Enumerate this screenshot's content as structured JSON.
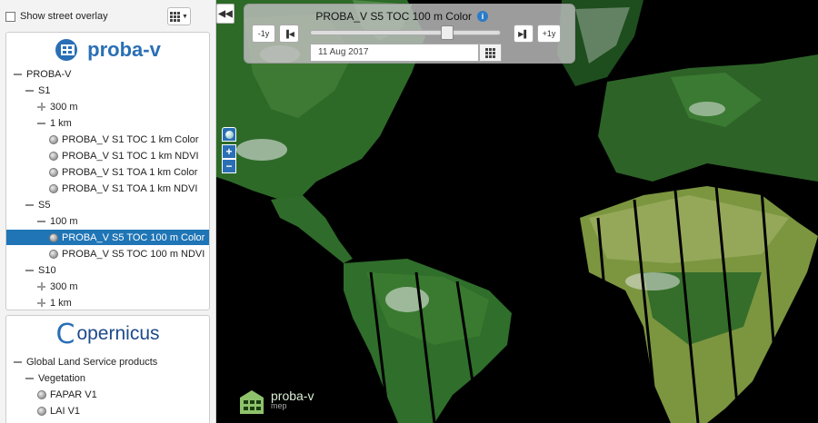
{
  "overlay": {
    "label": "Show street overlay",
    "checked": false,
    "grid_icon": "grid-icon"
  },
  "proba_logo": {
    "text": "proba-v"
  },
  "proba_tree": [
    {
      "label": "PROBA-V",
      "icon": "minus",
      "level": 0
    },
    {
      "label": "S1",
      "icon": "minus",
      "level": 1
    },
    {
      "label": "300 m",
      "icon": "plus",
      "level": 2
    },
    {
      "label": "1 km",
      "icon": "minus",
      "level": 2
    },
    {
      "label": "PROBA_V S1 TOC 1 km Color",
      "icon": "globe",
      "level": 3
    },
    {
      "label": "PROBA_V S1 TOC 1 km NDVI",
      "icon": "globe",
      "level": 3
    },
    {
      "label": "PROBA_V S1 TOA 1 km Color",
      "icon": "globe",
      "level": 3
    },
    {
      "label": "PROBA_V S1 TOA 1 km NDVI",
      "icon": "globe",
      "level": 3
    },
    {
      "label": "S5",
      "icon": "minus",
      "level": 1
    },
    {
      "label": "100 m",
      "icon": "minus",
      "level": 2
    },
    {
      "label": "PROBA_V S5 TOC 100 m Color",
      "icon": "globe",
      "level": 3,
      "selected": true
    },
    {
      "label": "PROBA_V S5 TOC 100 m NDVI",
      "icon": "globe",
      "level": 3
    },
    {
      "label": "S10",
      "icon": "minus",
      "level": 1
    },
    {
      "label": "300 m",
      "icon": "plus",
      "level": 2
    },
    {
      "label": "1 km",
      "icon": "plus",
      "level": 2
    }
  ],
  "copernicus_logo": {
    "text": "opernicus",
    "c_letter": "C"
  },
  "copernicus_tree": [
    {
      "label": "Global Land Service products",
      "icon": "minus",
      "level": 0
    },
    {
      "label": "Vegetation",
      "icon": "minus",
      "level": 1
    },
    {
      "label": "FAPAR V1",
      "icon": "globe",
      "level": 2
    },
    {
      "label": "LAI V1",
      "icon": "globe",
      "level": 2
    }
  ],
  "time_control": {
    "title": "PROBA_V S5 TOC 100 m Color",
    "info_icon": "info-icon",
    "minus_year": "-1y",
    "plus_year": "+1y",
    "date": "11 Aug 2017",
    "slider_position": 0.72
  },
  "map_controls": {
    "zoom_in": "+",
    "zoom_out": "−",
    "collapse": "◀◀"
  },
  "mep_logo": {
    "word": "proba-v",
    "sub": "mep"
  },
  "colors": {
    "selected": "#1f75b6",
    "accent": "#2a6fb5",
    "land_green": "#2f6b2a"
  }
}
